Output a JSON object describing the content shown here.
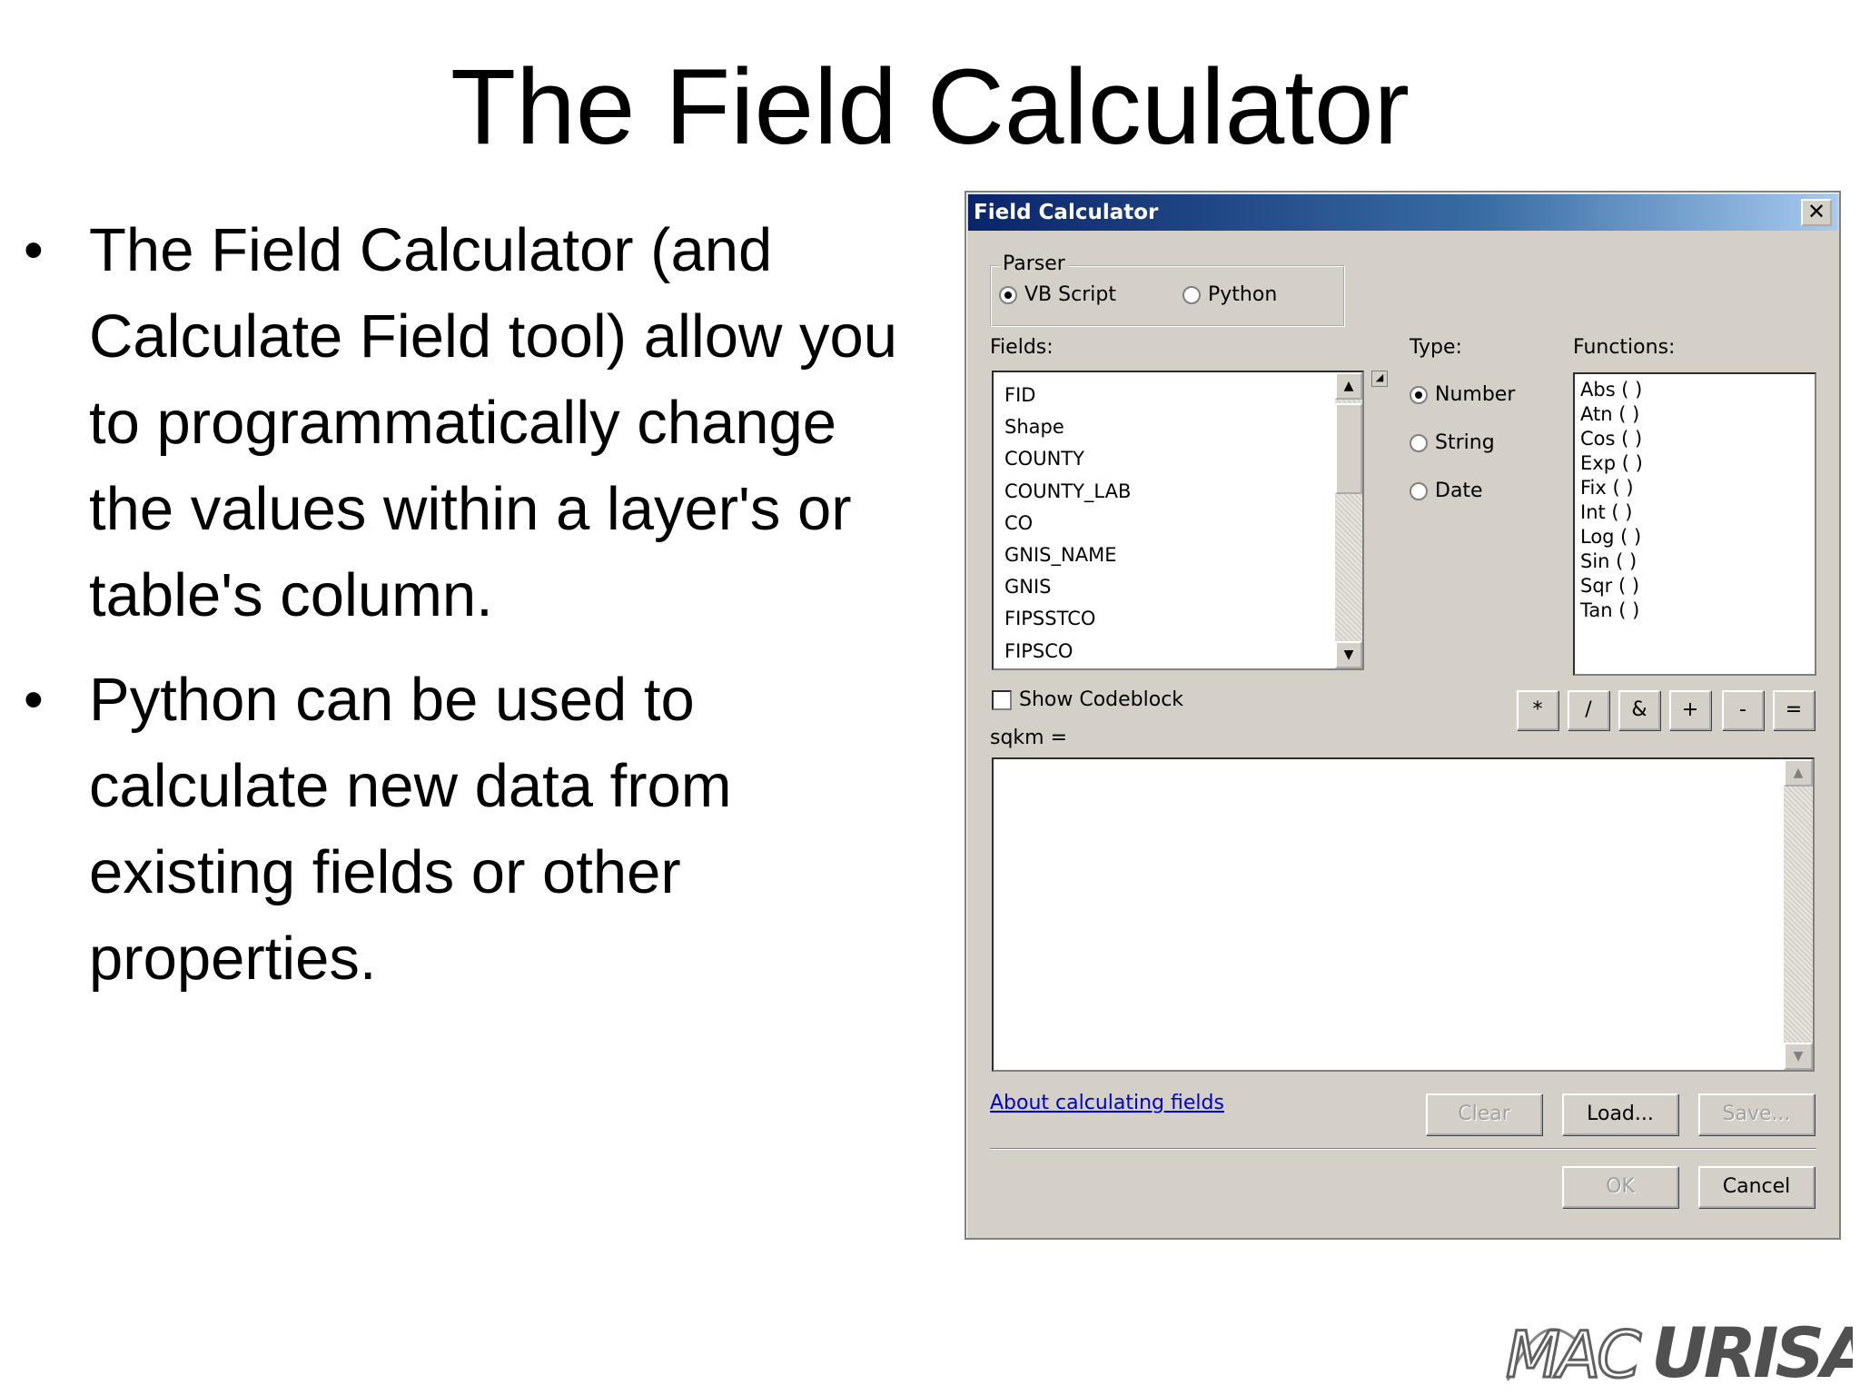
{
  "slide": {
    "title": "The Field Calculator",
    "bullets": [
      "The Field Calculator (and Calculate Field tool) allow you to programmatically change the values within a layer's or table's column.",
      "Python can be used to calculate new data from existing fields or other properties."
    ],
    "bullet_glyph": "•",
    "logo_text": "MACURISA"
  },
  "dialog": {
    "title": "Field Calculator",
    "close_glyph": "✕",
    "parser": {
      "legend": "Parser",
      "options": [
        "VB Script",
        "Python"
      ],
      "selected": "VB Script"
    },
    "fields_label": "Fields:",
    "fields": [
      "FID",
      "Shape",
      "COUNTY",
      "COUNTY_LAB",
      "CO",
      "GNIS_NAME",
      "GNIS",
      "FIPSSTCO",
      "FIPSCO"
    ],
    "type_label": "Type:",
    "types": [
      "Number",
      "String",
      "Date"
    ],
    "type_selected": "Number",
    "functions_label": "Functions:",
    "functions": [
      "Abs ( )",
      "Atn ( )",
      "Cos ( )",
      "Exp ( )",
      "Fix ( )",
      "Int ( )",
      "Log ( )",
      "Sin ( )",
      "Sqr ( )",
      "Tan ( )"
    ],
    "show_codeblock_label": "Show Codeblock",
    "operators": [
      "*",
      "/",
      "&",
      "+",
      "-",
      "="
    ],
    "expression_label": "sqkm =",
    "expression_value": "",
    "help_link": "About calculating fields",
    "buttons": {
      "clear": "Clear",
      "load": "Load...",
      "save": "Save...",
      "ok": "OK",
      "cancel": "Cancel"
    },
    "colors": {
      "face": "#d4d0c8",
      "titlebar_start": "#0a246a",
      "titlebar_end": "#a6caf0",
      "link": "#0000cc"
    }
  }
}
